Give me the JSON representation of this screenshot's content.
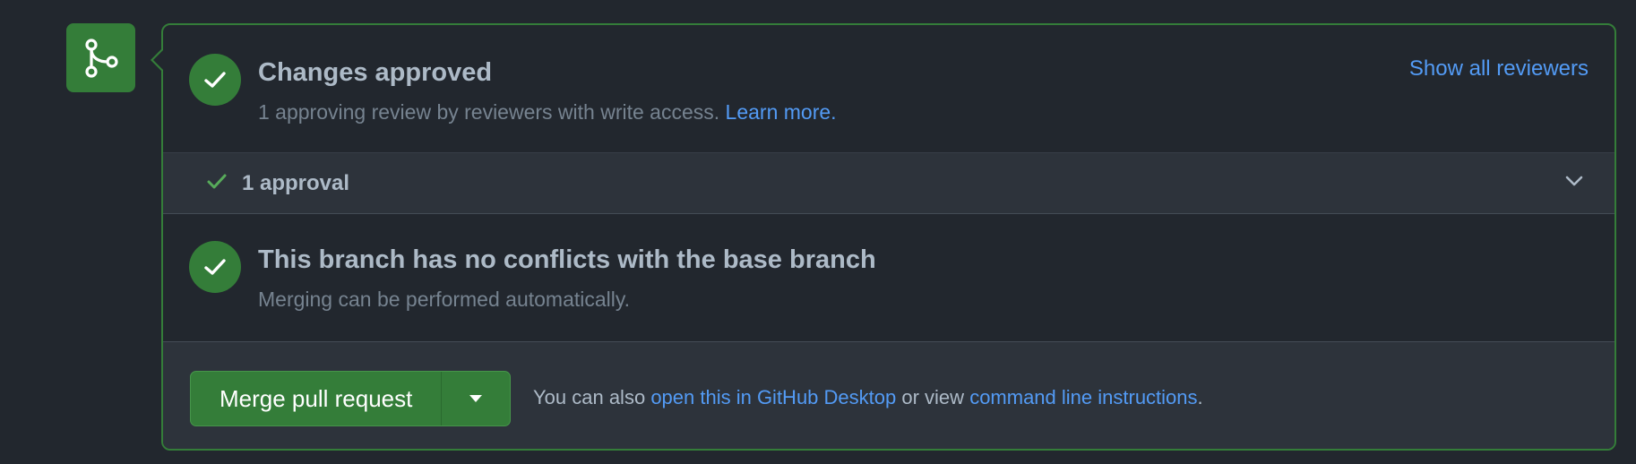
{
  "approved": {
    "title": "Changes approved",
    "subtitle_text": "1 approving review by reviewers with write access.",
    "learn_more": "Learn more.",
    "show_all_reviewers": "Show all reviewers"
  },
  "approvals": {
    "label": "1 approval"
  },
  "branch": {
    "title": "This branch has no conflicts with the base branch",
    "subtitle": "Merging can be performed automatically."
  },
  "merge": {
    "button_label": "Merge pull request",
    "note_prefix": "You can also",
    "desktop_link": "open this in GitHub Desktop",
    "note_middle": "or view",
    "cli_link": "command line instructions",
    "note_suffix": "."
  },
  "colors": {
    "accent_green": "#347d39",
    "link_blue": "#539bf5",
    "background": "#22272e",
    "panel_muted_bg": "#2d333b"
  },
  "icons": {
    "merge_badge": "git-merge-icon",
    "status": "check-circle-icon",
    "approval": "check-icon",
    "expand": "chevron-down-icon",
    "dropdown": "triangle-down-icon"
  }
}
